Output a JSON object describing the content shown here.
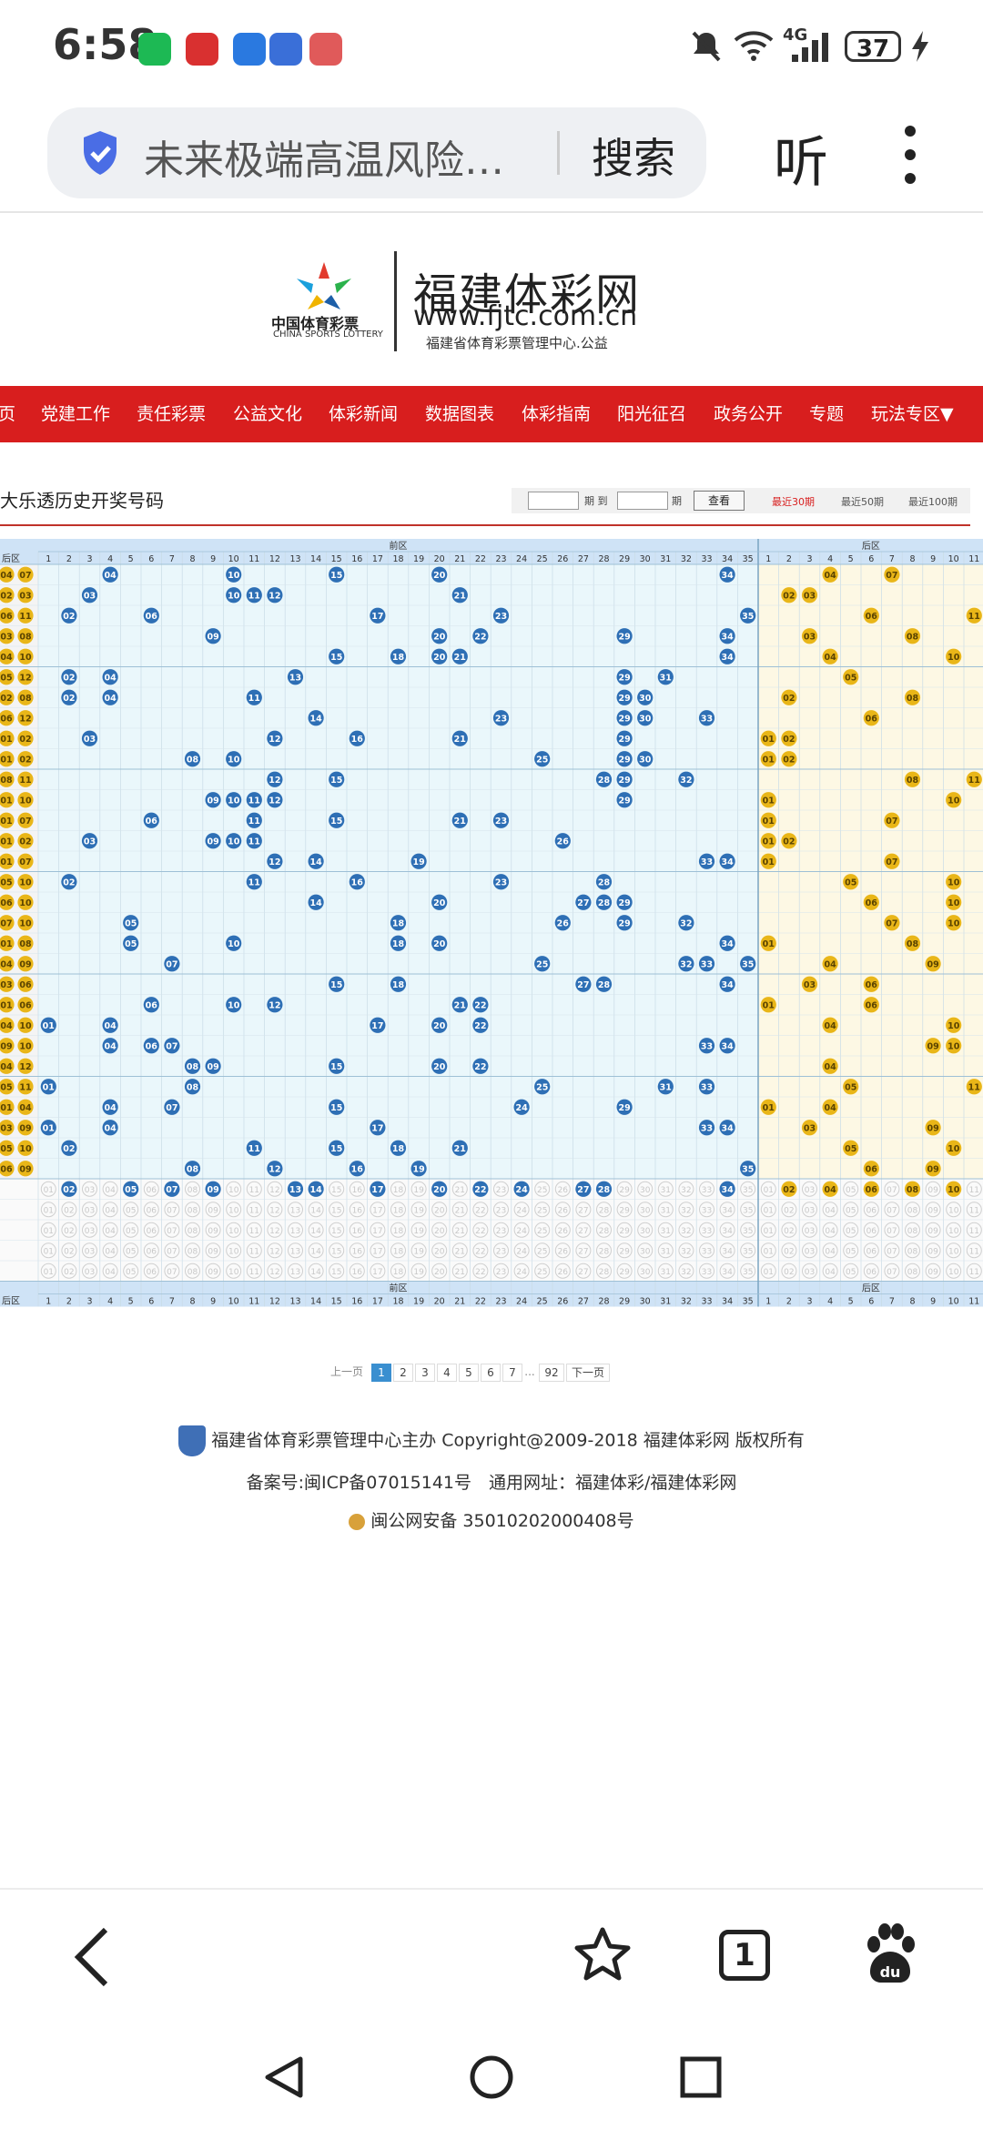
{
  "status": {
    "time": "6:58",
    "network": "4G",
    "battery": "37"
  },
  "browser": {
    "address_text": "未来极端高温风险…",
    "search_label": "搜索",
    "listen_label": "听"
  },
  "site": {
    "logo_cn": "中国体育彩票",
    "logo_en": "CHINA SPORTS LOTTERY",
    "name": "福建体彩网",
    "url": "www.fjtc.com.cn",
    "subtitle": "福建省体育彩票管理中心.公益"
  },
  "nav": [
    "页",
    "党建工作",
    "责任彩票",
    "公益文化",
    "体彩新闻",
    "数据图表",
    "体彩指南",
    "阳光征召",
    "政务公开",
    "专题",
    "玩法专区▼"
  ],
  "chart_header": {
    "title": "大乐透历史开奖号码",
    "from_label": "期 到",
    "to_label": "期",
    "query_button": "查看",
    "tabs": [
      "最近30期",
      "最近50期",
      "最近100期"
    ]
  },
  "chart_data": {
    "type": "table",
    "title": "大乐透历史开奖号码",
    "zones": {
      "front": "前区",
      "back": "后区",
      "back_col_label": "后区"
    },
    "front_columns": [
      1,
      2,
      3,
      4,
      5,
      6,
      7,
      8,
      9,
      10,
      11,
      12,
      13,
      14,
      15,
      16,
      17,
      18,
      19,
      20,
      21,
      22,
      23,
      24,
      25,
      26,
      27,
      28,
      29,
      30,
      31,
      32,
      33,
      34,
      35
    ],
    "back_columns": [
      1,
      2,
      3,
      4,
      5,
      6,
      7,
      8,
      9,
      10,
      11
    ],
    "rows": [
      {
        "b": [
          "04",
          "07"
        ],
        "f": [
          4,
          10,
          15,
          20,
          34
        ],
        "k": [
          4,
          7
        ]
      },
      {
        "b": [
          "02",
          "03"
        ],
        "f": [
          3,
          10,
          11,
          12,
          21
        ],
        "k": [
          2,
          3
        ]
      },
      {
        "b": [
          "06",
          "11"
        ],
        "f": [
          2,
          6,
          17,
          23,
          35
        ],
        "k": [
          6,
          11
        ]
      },
      {
        "b": [
          "03",
          "08"
        ],
        "f": [
          9,
          20,
          22,
          29,
          34
        ],
        "k": [
          3,
          8
        ]
      },
      {
        "b": [
          "04",
          "10"
        ],
        "f": [
          15,
          18,
          20,
          21,
          34
        ],
        "k": [
          4,
          10
        ]
      },
      {
        "b": [
          "05",
          "12"
        ],
        "f": [
          2,
          4,
          13,
          29,
          31
        ],
        "k": [
          5,
          12
        ]
      },
      {
        "b": [
          "02",
          "08"
        ],
        "f": [
          2,
          4,
          11,
          29,
          30
        ],
        "k": [
          2,
          8
        ]
      },
      {
        "b": [
          "06",
          "12"
        ],
        "f": [
          14,
          23,
          29,
          30,
          33
        ],
        "k": [
          6,
          12
        ]
      },
      {
        "b": [
          "01",
          "02"
        ],
        "f": [
          3,
          12,
          16,
          21,
          29
        ],
        "k": [
          1,
          2
        ]
      },
      {
        "b": [
          "01",
          "02"
        ],
        "f": [
          8,
          10,
          25,
          29,
          30
        ],
        "k": [
          1,
          2
        ]
      },
      {
        "b": [
          "08",
          "11"
        ],
        "f": [
          12,
          15,
          28,
          29,
          32
        ],
        "k": [
          8,
          11
        ]
      },
      {
        "b": [
          "01",
          "10"
        ],
        "f": [
          9,
          10,
          11,
          12,
          29
        ],
        "k": [
          1,
          10
        ]
      },
      {
        "b": [
          "01",
          "07"
        ],
        "f": [
          6,
          11,
          15,
          21,
          23
        ],
        "k": [
          1,
          7
        ]
      },
      {
        "b": [
          "01",
          "02"
        ],
        "f": [
          3,
          9,
          10,
          11,
          26
        ],
        "k": [
          1,
          2
        ]
      },
      {
        "b": [
          "01",
          "07"
        ],
        "f": [
          12,
          14,
          19,
          33,
          34
        ],
        "k": [
          1,
          7
        ]
      },
      {
        "b": [
          "05",
          "10"
        ],
        "f": [
          2,
          11,
          16,
          23,
          28
        ],
        "k": [
          5,
          10
        ]
      },
      {
        "b": [
          "06",
          "10"
        ],
        "f": [
          14,
          20,
          27,
          28,
          29
        ],
        "k": [
          6,
          10
        ]
      },
      {
        "b": [
          "07",
          "10"
        ],
        "f": [
          5,
          18,
          26,
          29,
          32
        ],
        "k": [
          7,
          10
        ]
      },
      {
        "b": [
          "01",
          "08"
        ],
        "f": [
          5,
          10,
          18,
          20,
          34
        ],
        "k": [
          1,
          8
        ]
      },
      {
        "b": [
          "04",
          "09"
        ],
        "f": [
          7,
          25,
          32,
          33,
          35
        ],
        "k": [
          4,
          9
        ]
      },
      {
        "b": [
          "03",
          "06"
        ],
        "f": [
          15,
          18,
          27,
          28,
          34
        ],
        "k": [
          3,
          6
        ]
      },
      {
        "b": [
          "01",
          "06"
        ],
        "f": [
          6,
          10,
          12,
          21,
          22
        ],
        "k": [
          1,
          6
        ]
      },
      {
        "b": [
          "04",
          "10"
        ],
        "f": [
          1,
          4,
          17,
          20,
          22
        ],
        "k": [
          4,
          10
        ]
      },
      {
        "b": [
          "09",
          "10"
        ],
        "f": [
          4,
          6,
          7,
          33,
          34
        ],
        "k": [
          9,
          10
        ]
      },
      {
        "b": [
          "04",
          "12"
        ],
        "f": [
          8,
          9,
          15,
          20,
          22
        ],
        "k": [
          4,
          12
        ]
      },
      {
        "b": [
          "05",
          "11"
        ],
        "f": [
          1,
          8,
          25,
          31,
          33
        ],
        "k": [
          5,
          11
        ]
      },
      {
        "b": [
          "01",
          "04"
        ],
        "f": [
          4,
          7,
          15,
          24,
          29
        ],
        "k": [
          1,
          4
        ]
      },
      {
        "b": [
          "03",
          "09"
        ],
        "f": [
          1,
          4,
          17,
          33,
          34
        ],
        "k": [
          3,
          9
        ]
      },
      {
        "b": [
          "05",
          "10"
        ],
        "f": [
          2,
          11,
          15,
          18,
          21
        ],
        "k": [
          5,
          10
        ]
      },
      {
        "b": [
          "06",
          "09"
        ],
        "f": [
          8,
          12,
          16,
          19,
          35
        ],
        "k": [
          6,
          9
        ]
      }
    ],
    "select_row_front": [
      2,
      5,
      7,
      9,
      13,
      14,
      17,
      20,
      22,
      24,
      27,
      28,
      34
    ],
    "select_row_back": [
      2,
      4,
      6,
      8,
      10
    ]
  },
  "pager": {
    "prev": "上一页",
    "pages": [
      "1",
      "2",
      "3",
      "4",
      "5",
      "6",
      "7"
    ],
    "ellipsis": "...",
    "last": "92",
    "next": "下一页"
  },
  "footer": {
    "line1": "福建省体育彩票管理中心主办 Copyright@2009-2018 福建体彩网 版权所有",
    "line2": "备案号:闽ICP备07015141号　通用网址：福建体彩/福建体彩网",
    "line3": "闽公网安备 35010202000408号"
  },
  "colors": {
    "nav_red": "#d81e1e",
    "front_ball": "#2e6fb5",
    "back_ball": "#e9b618",
    "front_bg": "#eaf7fb",
    "back_bg": "#fdf8e4",
    "header_blue": "#cfe3f6"
  }
}
